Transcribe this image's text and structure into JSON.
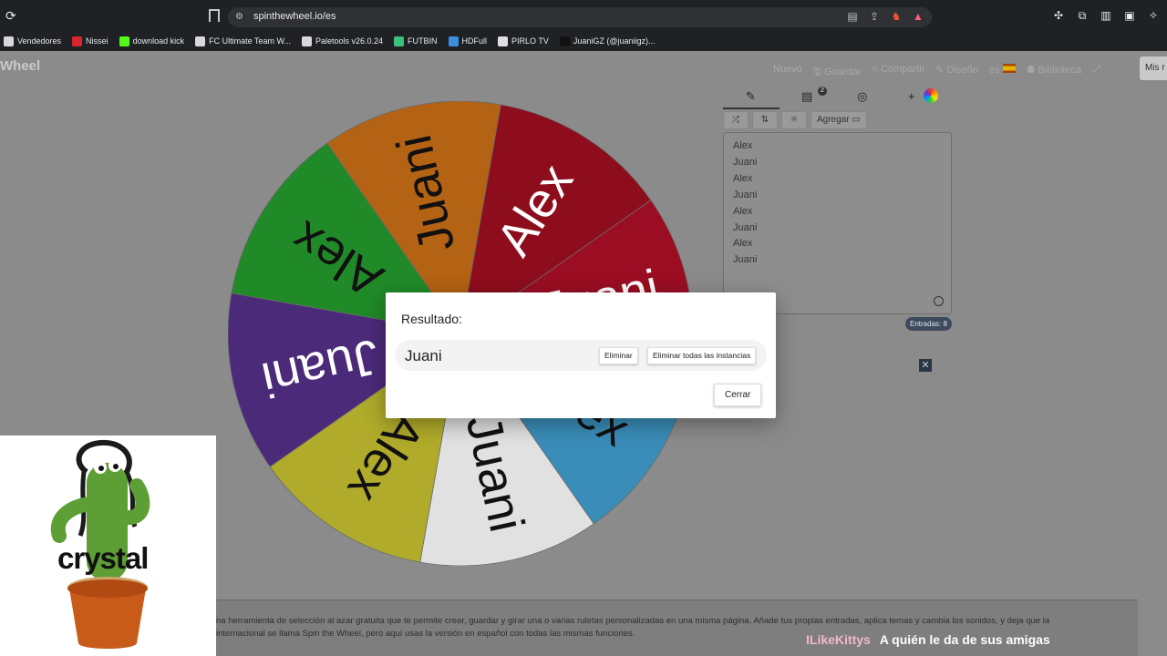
{
  "browser": {
    "url": "spinthewheel.io/es",
    "bookmarks": [
      {
        "label": "Vendedores",
        "color": "#d9d9d9"
      },
      {
        "label": "Nissei",
        "color": "#d6262e"
      },
      {
        "label": "download kick",
        "color": "#53fc18"
      },
      {
        "label": "FC Ultimate Team W...",
        "color": "#d9d9d9"
      },
      {
        "label": "Paletools v26.0.24",
        "color": "#d9d9d9"
      },
      {
        "label": "FUTBIN",
        "color": "#3ac27a"
      },
      {
        "label": "HDFull",
        "color": "#3d8de0"
      },
      {
        "label": "PIRLO TV",
        "color": "#e0e0e0"
      },
      {
        "label": "JuaniGZ (@juaniigz)...",
        "color": "#111111"
      }
    ]
  },
  "app": {
    "logo": "Wheel",
    "nav": [
      "Nuevo",
      "Guardar",
      "Compartir",
      "Diseño",
      "es",
      "Biblioteca"
    ],
    "mis_label": "Mis r",
    "tab_badge": "2",
    "add_label": "Agregar",
    "entries": [
      "Alex",
      "Juani",
      "Alex",
      "Juani",
      "Alex",
      "Juani",
      "Alex",
      "Juani"
    ],
    "entries_count": "Entradas: 8",
    "footer_line1": "na herramienta de selección al azar gratuita que te permite crear, guardar y girar una o varias ruletas personalizadas en una misma página. Añade tus propias entradas, aplica temas y cambia los sonidos, y deja que la",
    "footer_line2": "internacional se llama Spin the Wheel, pero aquí usas la versión en español con todas las mismas funciones."
  },
  "wheel": {
    "labels": [
      "Alex",
      "Juani",
      "Alex",
      "Juani",
      "Alex",
      "Juani",
      "Alex",
      "Juani"
    ],
    "colors": [
      "#8e0d1d",
      "#9b0d22",
      "#3a8db8",
      "#e1e1e1",
      "#b0ab2a",
      "#4c2a7a",
      "#208a28",
      "#b46213"
    ]
  },
  "modal": {
    "title": "Resultado:",
    "result": "Juani",
    "remove_label": "Eliminar",
    "remove_all_label": "Eliminar todas las instancias",
    "close_label": "Cerrar"
  },
  "overlay": {
    "caption": "crystal",
    "stream_user": "ILikeKittys",
    "stream_message": "A quién le da de sus amigas"
  }
}
